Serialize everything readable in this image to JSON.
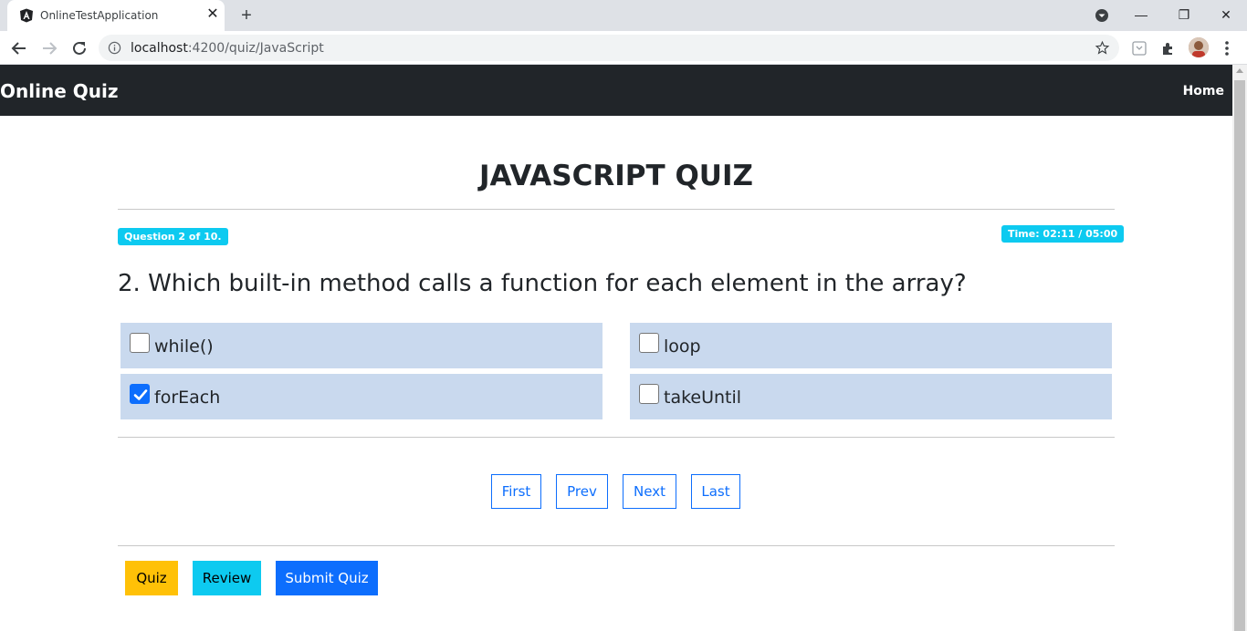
{
  "browser": {
    "tab_title": "OnlineTestApplication",
    "url_host": "localhost",
    "url_path": ":4200/quiz/JavaScript"
  },
  "navbar": {
    "brand": "Online Quiz",
    "home_link": "Home"
  },
  "quiz": {
    "title": "JAVASCRIPT QUIZ",
    "question_badge": "Question 2 of 10.",
    "timer_badge": "Time: 02:11 / 05:00",
    "question_text": "2. Which built-in method calls a function for each element in the array?",
    "options": [
      {
        "label": "while()",
        "checked": false
      },
      {
        "label": "loop",
        "checked": false
      },
      {
        "label": "forEach",
        "checked": true
      },
      {
        "label": "takeUntil",
        "checked": false
      }
    ]
  },
  "pager": {
    "first": "First",
    "prev": "Prev",
    "next": "Next",
    "last": "Last"
  },
  "actions": {
    "quiz": "Quiz",
    "review": "Review",
    "submit": "Submit Quiz"
  },
  "colors": {
    "navbar_bg": "#212529",
    "badge_bg": "#0dcaf0",
    "option_bg": "#c9d9ee",
    "primary": "#0d6efd",
    "warning": "#ffc107",
    "info": "#0dcaf0"
  }
}
